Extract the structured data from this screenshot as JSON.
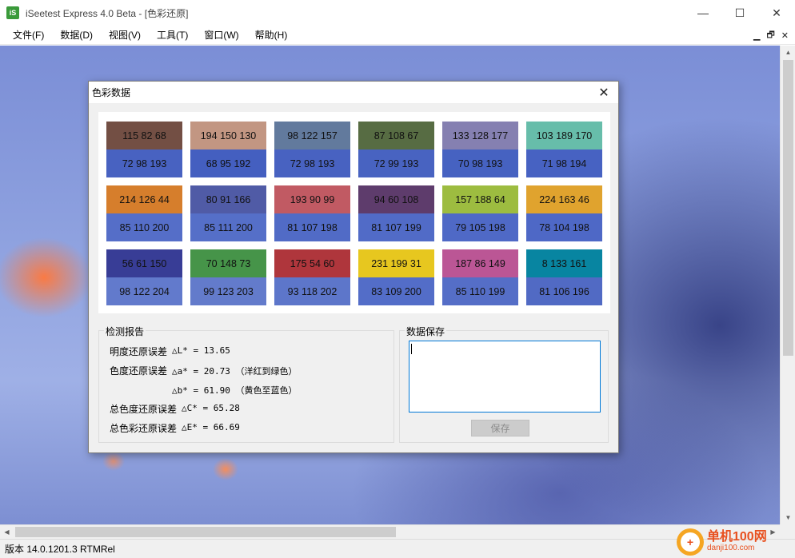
{
  "window": {
    "icon_text": "iS",
    "title": "iSeetest Express 4.0 Beta - [色彩还原]",
    "minimize": "—",
    "maximize": "☐",
    "close": "✕"
  },
  "menu": [
    "文件(F)",
    "数据(D)",
    "视图(V)",
    "工具(T)",
    "窗口(W)",
    "帮助(H)"
  ],
  "mdi_controls": {
    "minimize": "▁",
    "restore": "🗗",
    "close": "✕"
  },
  "dialog": {
    "title": "色彩数据",
    "close": "✕",
    "swatches": [
      {
        "top": "115 82 68",
        "bottom": "72 98 193",
        "top_color": "#734f44",
        "bottom_color": "#4862c1"
      },
      {
        "top": "194 150 130",
        "bottom": "68 95 192",
        "top_color": "#c29682",
        "bottom_color": "#445fc0"
      },
      {
        "top": "98 122 157",
        "bottom": "72 98 193",
        "top_color": "#627a9d",
        "bottom_color": "#4862c1"
      },
      {
        "top": "87 108 67",
        "bottom": "72 99 193",
        "top_color": "#576c43",
        "bottom_color": "#4863c1"
      },
      {
        "top": "133 128 177",
        "bottom": "70 98 193",
        "top_color": "#8580b1",
        "bottom_color": "#4662c1"
      },
      {
        "top": "103 189 170",
        "bottom": "71 98 194",
        "top_color": "#67bdaa",
        "bottom_color": "#4762c2"
      },
      {
        "top": "214 126 44",
        "bottom": "85 110 200",
        "top_color": "#d67e2c",
        "bottom_color": "#556ec8"
      },
      {
        "top": "80 91 166",
        "bottom": "85 111 200",
        "top_color": "#505ba6",
        "bottom_color": "#556fc8"
      },
      {
        "top": "193 90 99",
        "bottom": "81 107 198",
        "top_color": "#c15a63",
        "bottom_color": "#516bc6"
      },
      {
        "top": "94 60 108",
        "bottom": "81 107 199",
        "top_color": "#5e3c6c",
        "bottom_color": "#516bc7"
      },
      {
        "top": "157 188 64",
        "bottom": "79 105 198",
        "top_color": "#9dbc40",
        "bottom_color": "#4f69c6"
      },
      {
        "top": "224 163 46",
        "bottom": "78 104 198",
        "top_color": "#e0a32e",
        "bottom_color": "#4e68c6"
      },
      {
        "top": "56 61 150",
        "bottom": "98 122 204",
        "top_color": "#383d96",
        "bottom_color": "#627acc"
      },
      {
        "top": "70 148 73",
        "bottom": "99 123 203",
        "top_color": "#469449",
        "bottom_color": "#637bcb"
      },
      {
        "top": "175 54 60",
        "bottom": "93 118 202",
        "top_color": "#af363c",
        "bottom_color": "#5d76ca"
      },
      {
        "top": "231 199 31",
        "bottom": "83 109 200",
        "top_color": "#e7c71f",
        "bottom_color": "#536dc8"
      },
      {
        "top": "187 86 149",
        "bottom": "85 110 199",
        "top_color": "#bb5695",
        "bottom_color": "#556ec7"
      },
      {
        "top": "8 133 161",
        "bottom": "81 106 196",
        "top_color": "#0885a1",
        "bottom_color": "#516ac4"
      }
    ],
    "report": {
      "label": "检测报告",
      "lines": [
        {
          "label": "明度还原误差",
          "value": "△L* = 13.65"
        },
        {
          "label": "色度还原误差",
          "value": "△a* = 20.73 （洋红到绿色）"
        },
        {
          "label": "",
          "value": "△b* = 61.90 （黄色至蓝色）"
        },
        {
          "label": "总色度还原误差",
          "value": "△C* = 65.28"
        },
        {
          "label": "总色彩还原误差",
          "value": "△E* = 66.69"
        }
      ]
    },
    "save": {
      "label": "数据保存",
      "textarea_value": "",
      "button": "保存"
    }
  },
  "statusbar": {
    "version": "版本 14.0.1201.3 RTMRel"
  },
  "watermark": {
    "logo": "+",
    "name": "单机100网",
    "url": "danji100.com"
  }
}
